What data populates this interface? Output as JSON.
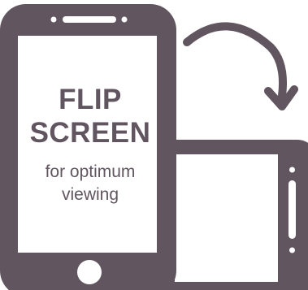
{
  "message": {
    "headline_line1": "FLIP",
    "headline_line2": "SCREEN",
    "subtext_line1": "for optimum",
    "subtext_line2": "viewing"
  },
  "colors": {
    "device": "#615660",
    "screen": "#ffffff",
    "text": "#615660"
  },
  "icons": {
    "portrait": "portrait-phone-icon",
    "landscape": "landscape-phone-icon",
    "rotate": "rotate-arrow-icon"
  }
}
